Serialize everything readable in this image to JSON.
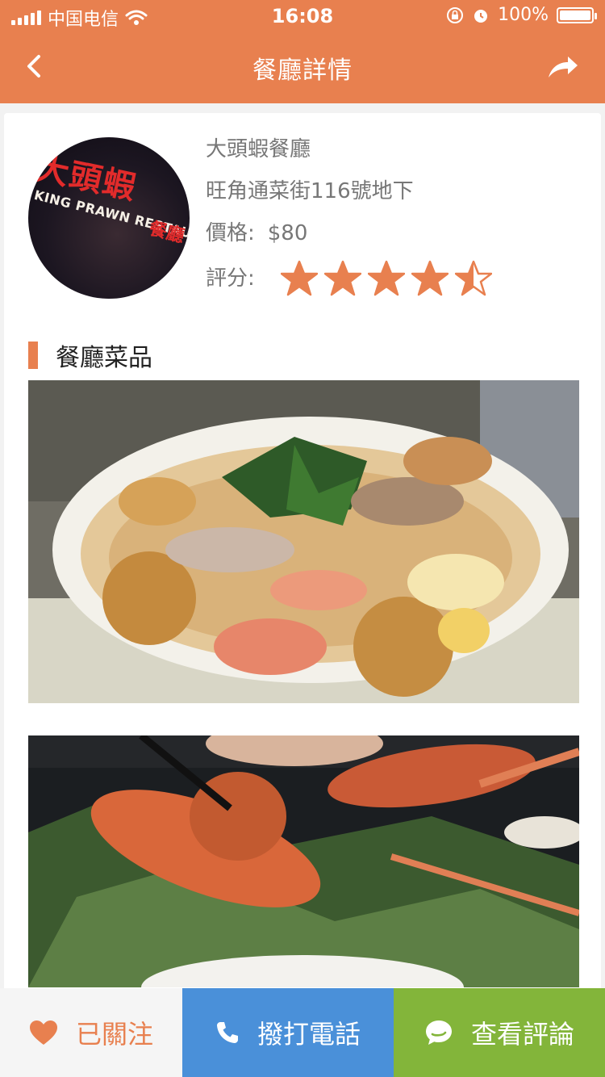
{
  "status_bar": {
    "carrier": "中国电信",
    "time": "16:08",
    "battery": "100%",
    "battery_level": 1.0
  },
  "nav": {
    "title": "餐廳詳情",
    "back_icon": "chevron-left-icon",
    "share_icon": "share-arrow-icon"
  },
  "restaurant": {
    "logo_text_cn": "大頭蝦",
    "logo_text_cn_sub": "餐廳",
    "logo_text_en": "KING PRAWN RESTAURANT",
    "name": "大頭蝦餐廳",
    "address": "旺角通菜街116號地下",
    "price_label": "價格:",
    "price": "$80",
    "rating_label": "評分:",
    "rating": 4.5,
    "rating_max": 5
  },
  "dishes_section": {
    "title": "餐廳菜品",
    "photos": [
      "noodle-soup-with-prawns",
      "grilled-king-prawns"
    ]
  },
  "bottom_bar": {
    "follow_label": "已關注",
    "call_label": "撥打電話",
    "review_label": "查看評論"
  },
  "colors": {
    "accent": "#e8804f",
    "call": "#4a90d9",
    "review": "#83b53a"
  }
}
